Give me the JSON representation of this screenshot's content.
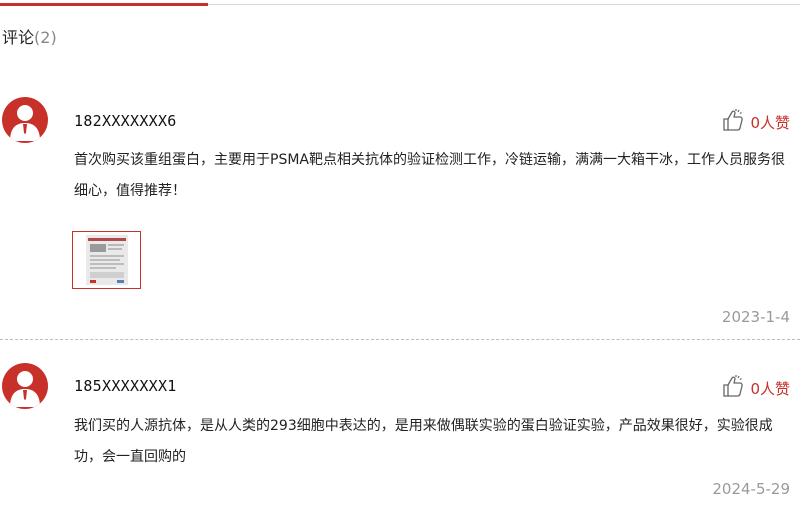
{
  "section": {
    "title": "评论",
    "count": "(2)"
  },
  "comments": [
    {
      "username": "182XXXXXXX6",
      "likes": "0人赞",
      "text": "首次购买该重组蛋白，主要用于PSMA靶点相关抗体的验证检测工作，冷链运输，满满一大箱干冰，工作人员服务很细心，值得推荐！",
      "date": "2023-1-4"
    },
    {
      "username": "185XXXXXXX1",
      "likes": "0人赞",
      "text": "我们买的人源抗体，是从人类的293细胞中表达的，是用来做偶联实验的蛋白验证实验，产品效果很好，实验很成功，会一直回购的",
      "date": "2024-5-29"
    }
  ],
  "colors": {
    "accent": "#c8302a",
    "muted": "#9a9a9a"
  },
  "icons": {
    "avatar": "user-avatar-icon",
    "like": "thumbs-up-icon",
    "attachment": "document-thumbnail"
  }
}
